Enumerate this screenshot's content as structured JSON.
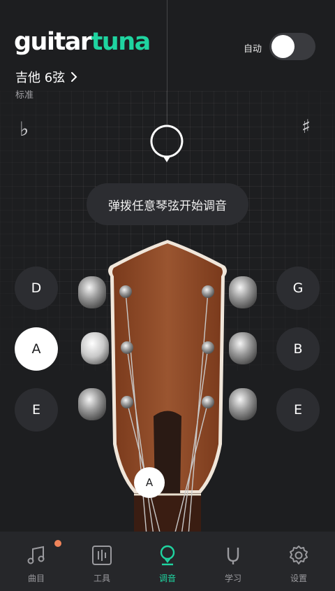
{
  "app": {
    "logo_part1": "guitar",
    "logo_part2": "tuna",
    "brand_color": "#1fd4a0"
  },
  "header": {
    "auto_label": "自动",
    "auto_enabled": false,
    "instrument": "吉他 6弦",
    "tuning": "标准"
  },
  "tuner": {
    "flat_symbol": "♭",
    "sharp_symbol": "♯",
    "prompt": "弹拨任意琴弦开始调音",
    "current_note": "A"
  },
  "strings": {
    "left": [
      {
        "label": "D",
        "active": false
      },
      {
        "label": "A",
        "active": true
      },
      {
        "label": "E",
        "active": false
      }
    ],
    "right": [
      {
        "label": "G",
        "active": false
      },
      {
        "label": "B",
        "active": false
      },
      {
        "label": "E",
        "active": false
      }
    ]
  },
  "nav": {
    "items": [
      {
        "label": "曲目",
        "icon": "music-note-icon",
        "badge": true
      },
      {
        "label": "工具",
        "icon": "tools-icon",
        "badge": false
      },
      {
        "label": "调音",
        "icon": "tuner-icon",
        "badge": false,
        "active": true
      },
      {
        "label": "学习",
        "icon": "learn-icon",
        "badge": false
      },
      {
        "label": "设置",
        "icon": "gear-icon",
        "badge": false
      }
    ]
  }
}
